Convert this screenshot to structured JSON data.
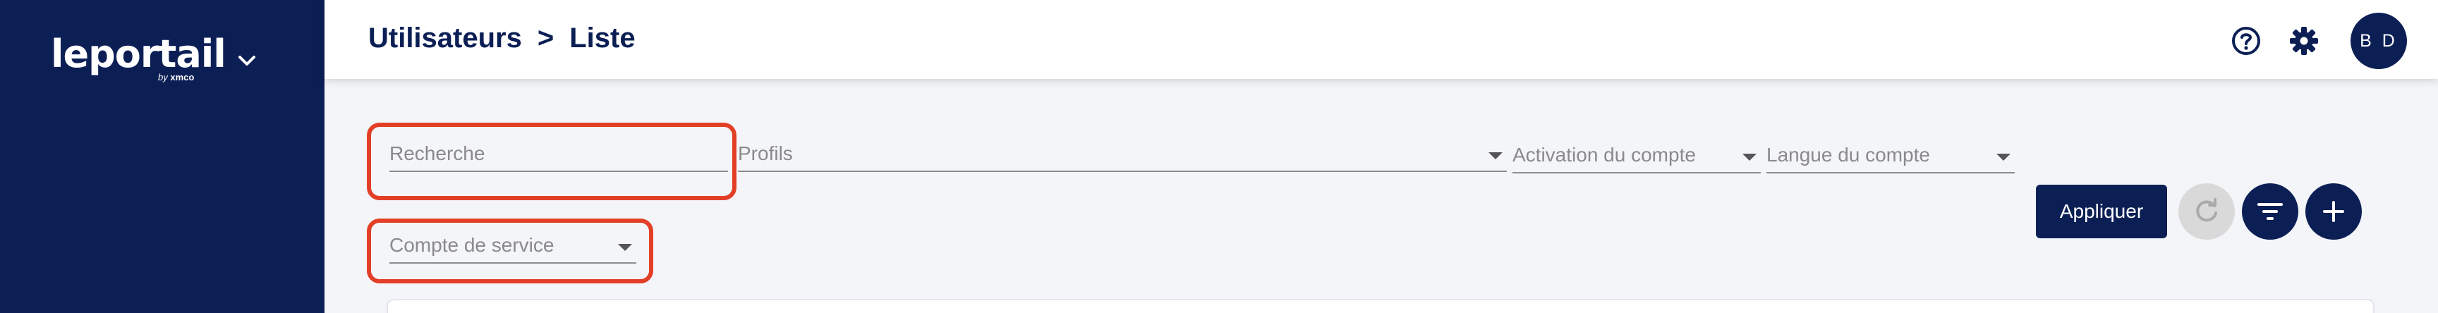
{
  "sidebar": {
    "brand_name": "leportail",
    "brand_by": "by",
    "brand_company": "xmco",
    "toggle_icon": "chevron-down-icon"
  },
  "header": {
    "breadcrumb_section": "Utilisateurs",
    "breadcrumb_separator": ">",
    "breadcrumb_page": "Liste",
    "help_icon": "help-circle-icon",
    "settings_icon": "gear-icon",
    "avatar_initials": "B D"
  },
  "filters": {
    "search_placeholder": "Recherche",
    "profiles_label": "Profils",
    "activation_label": "Activation du compte",
    "language_label": "Langue du compte",
    "service_account_label": "Compte de service",
    "apply_label": "Appliquer",
    "refresh_icon": "refresh-icon",
    "filter_icon": "filter-icon",
    "add_icon": "plus-icon"
  },
  "colors": {
    "navy": "#0c1f55",
    "highlight": "#e23f26",
    "disabled": "#d9d9d9"
  }
}
